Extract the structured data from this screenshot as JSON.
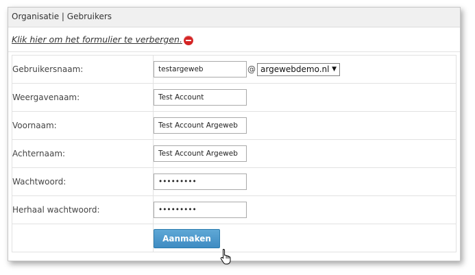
{
  "header": {
    "breadcrumb": "Organisatie | Gebruikers"
  },
  "toggle": {
    "label": "Klik hier om het formulier te verbergen."
  },
  "form": {
    "username": {
      "label": "Gebruikersnaam:",
      "value": "testargeweb",
      "at": "@",
      "domain": "argewebdemo.nl"
    },
    "displayname": {
      "label": "Weergavenaam:",
      "value": "Test Account"
    },
    "firstname": {
      "label": "Voornaam:",
      "value": "Test Account Argeweb"
    },
    "lastname": {
      "label": "Achternaam:",
      "value": "Test Account Argeweb"
    },
    "password": {
      "label": "Wachtwoord:",
      "value": "123456789"
    },
    "password_repeat": {
      "label": "Herhaal wachtwoord:",
      "value": "123456789"
    },
    "submit_label": "Aanmaken"
  },
  "icons": {
    "hide": "minus-circle-icon",
    "dropdown": "chevron-down-icon",
    "cursor": "hand-pointer-icon"
  }
}
